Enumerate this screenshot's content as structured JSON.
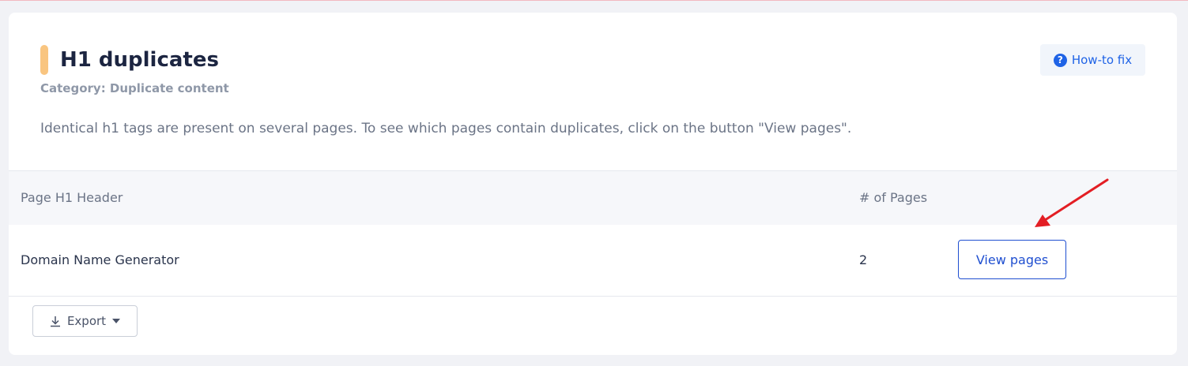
{
  "issue": {
    "title": "H1 duplicates",
    "category": "Category: Duplicate content",
    "description": "Identical h1 tags are present on several pages. To see which pages contain duplicates, click on the button \"View pages\".",
    "howto_label": "How-to fix",
    "howto_icon": "question-circle-icon"
  },
  "table": {
    "columns": [
      "Page H1 Header",
      "# of Pages"
    ],
    "rows": [
      {
        "header": "Domain Name Generator",
        "pages": "2",
        "action_label": "View pages"
      }
    ]
  },
  "footer": {
    "export_label": "Export",
    "export_icon": "download-icon",
    "dropdown_icon": "caret-down-icon"
  },
  "colors": {
    "accent": "#f9c580",
    "primary": "#1f63e6",
    "annotation_arrow": "#e31e24"
  }
}
